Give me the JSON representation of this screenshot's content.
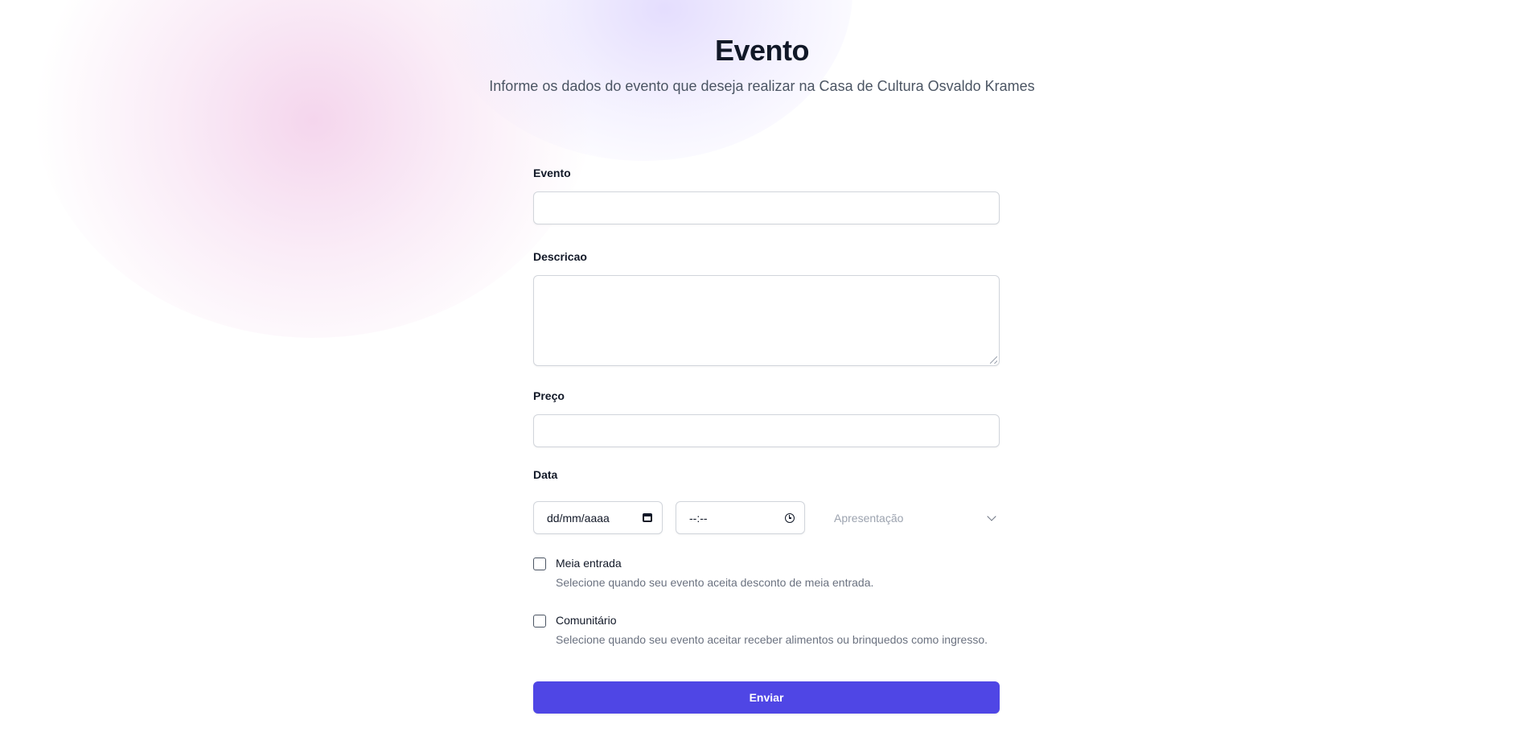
{
  "header": {
    "title": "Evento",
    "subtitle": "Informe os dados do evento que deseja realizar na Casa de Cultura Osvaldo Krames"
  },
  "form": {
    "evento": {
      "label": "Evento",
      "value": ""
    },
    "descricao": {
      "label": "Descricao",
      "value": ""
    },
    "preco": {
      "label": "Preço",
      "value": ""
    },
    "data": {
      "label": "Data",
      "date_placeholder": "dd/mm/aaaa",
      "time_placeholder": "--:--",
      "select_placeholder": "Apresentação"
    },
    "meia_entrada": {
      "label": "Meia entrada",
      "help": "Selecione quando seu evento aceita desconto de meia entrada.",
      "checked": false
    },
    "comunitario": {
      "label": "Comunitário",
      "help": "Selecione quando seu evento aceitar receber alimentos ou brinquedos como ingresso.",
      "checked": false
    },
    "submit_label": "Enviar"
  },
  "colors": {
    "accent": "#4f46e5",
    "border": "#d1d5db",
    "muted_text": "#6b7280"
  },
  "icons": {
    "date": "calendar-icon",
    "time": "clock-icon",
    "select": "chevron-down-icon"
  }
}
